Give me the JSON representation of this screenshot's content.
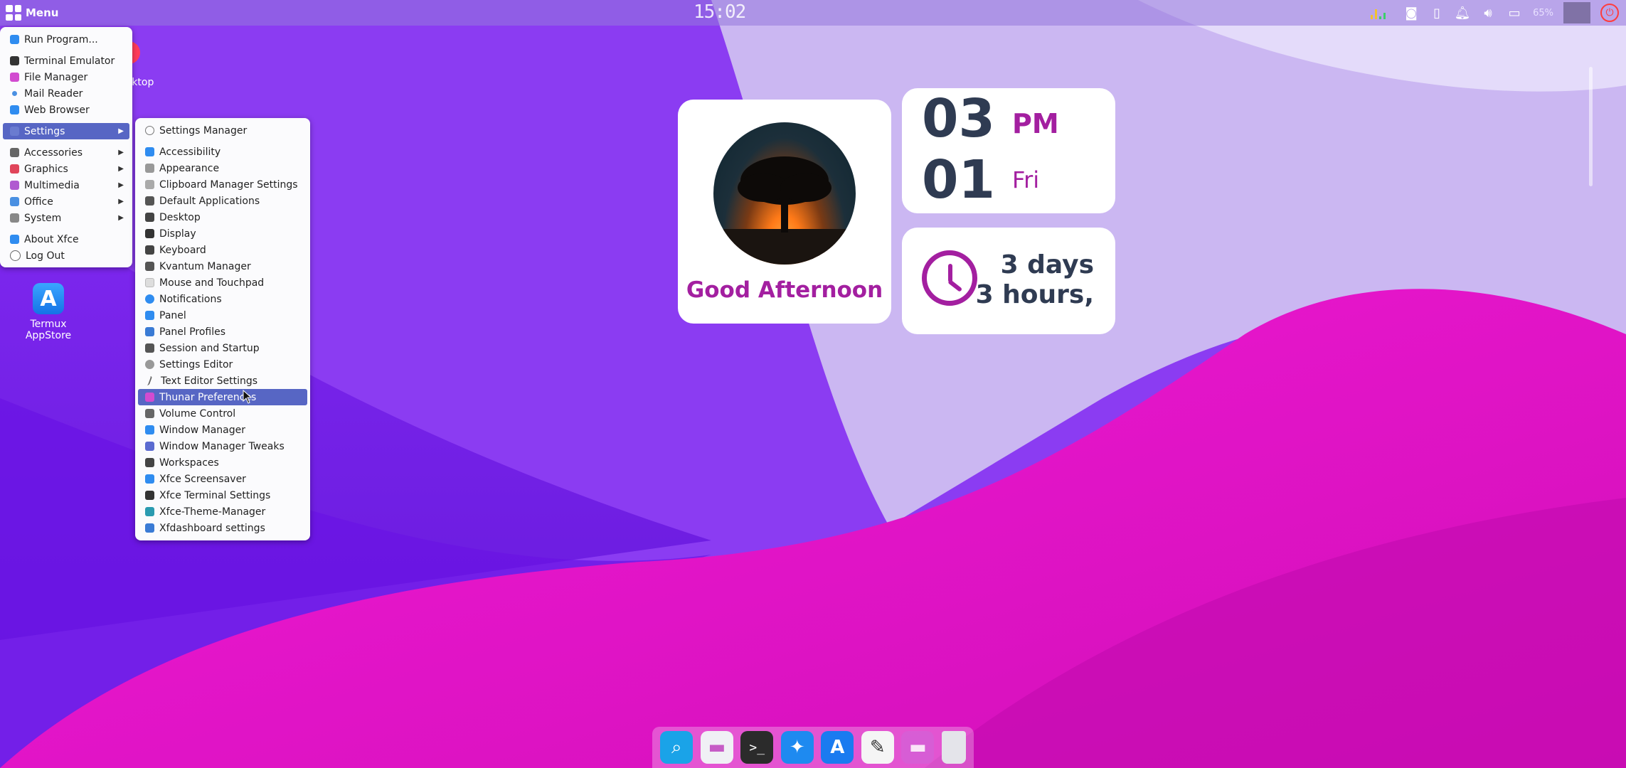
{
  "top_panel": {
    "menu_label": "Menu",
    "clock": "15:02",
    "battery_text": "65%"
  },
  "desktop": {
    "partial_label": "sktop",
    "icons": [
      {
        "label_line1": "Termux",
        "label_line2": "AppStore",
        "icon": "appstore-icon"
      }
    ]
  },
  "main_menu": {
    "items": [
      {
        "label": "Run Program...",
        "icon": "run-icon",
        "color": "#2f8cf0"
      },
      {
        "label": "Terminal Emulator",
        "icon": "terminal-icon",
        "color": "#333"
      },
      {
        "label": "File Manager",
        "icon": "folder-icon",
        "color": "#d24bd0"
      },
      {
        "label": "Mail Reader",
        "icon": "mail-icon",
        "color": "#4a90e2"
      },
      {
        "label": "Web Browser",
        "icon": "browser-icon",
        "color": "#2f8cf0"
      },
      {
        "label": "Settings",
        "icon": "settings-icon",
        "color": "#6a7bd0"
      },
      {
        "label": "Accessories",
        "icon": "accessories-icon",
        "color": "#666"
      },
      {
        "label": "Graphics",
        "icon": "graphics-icon",
        "color": "#e0455a"
      },
      {
        "label": "Multimedia",
        "icon": "multimedia-icon",
        "color": "#b05ad0"
      },
      {
        "label": "Office",
        "icon": "office-icon",
        "color": "#4a90e2"
      },
      {
        "label": "System",
        "icon": "system-icon",
        "color": "#888"
      },
      {
        "label": "About Xfce",
        "icon": "about-icon",
        "color": "#2f8cf0"
      },
      {
        "label": "Log Out",
        "icon": "logout-icon",
        "color": "#666"
      }
    ]
  },
  "settings_menu": {
    "items": [
      {
        "label": "Settings Manager",
        "color": "#777"
      },
      {
        "label": "Accessibility",
        "color": "#2f8cf0"
      },
      {
        "label": "Appearance",
        "color": "#999"
      },
      {
        "label": "Clipboard Manager Settings",
        "color": "#aaa"
      },
      {
        "label": "Default Applications",
        "color": "#555"
      },
      {
        "label": "Desktop",
        "color": "#444"
      },
      {
        "label": "Display",
        "color": "#333"
      },
      {
        "label": "Keyboard",
        "color": "#444"
      },
      {
        "label": "Kvantum Manager",
        "color": "#555"
      },
      {
        "label": "Mouse and Touchpad",
        "color": "#bbb"
      },
      {
        "label": "Notifications",
        "color": "#2f8cf0"
      },
      {
        "label": "Panel",
        "color": "#2f8cf0"
      },
      {
        "label": "Panel Profiles",
        "color": "#3a7bd5"
      },
      {
        "label": "Session and Startup",
        "color": "#555"
      },
      {
        "label": "Settings Editor",
        "color": "#999"
      },
      {
        "label": "Text Editor Settings",
        "color": "#666"
      },
      {
        "label": "Thunar Preferences",
        "color": "#d24bd0"
      },
      {
        "label": "Volume Control",
        "color": "#666"
      },
      {
        "label": "Window Manager",
        "color": "#2f8cf0"
      },
      {
        "label": "Window Manager Tweaks",
        "color": "#5a6ad0"
      },
      {
        "label": "Workspaces",
        "color": "#444"
      },
      {
        "label": "Xfce Screensaver",
        "color": "#2f8cf0"
      },
      {
        "label": "Xfce Terminal Settings",
        "color": "#333"
      },
      {
        "label": "Xfce-Theme-Manager",
        "color": "#2a9bb0"
      },
      {
        "label": "Xfdashboard settings",
        "color": "#3a7bd5"
      }
    ]
  },
  "widgets": {
    "greeting": "Good Afternoon",
    "hour": "03",
    "minute": "01",
    "ampm": "PM",
    "day": "Fri",
    "uptime_line1": "3 days",
    "uptime_line2": "3 hours,"
  },
  "dock": {
    "items": [
      {
        "icon": "search-icon",
        "color": "#1aa3e8"
      },
      {
        "icon": "folder-icon",
        "color": "#f0f0f5"
      },
      {
        "icon": "terminal-icon",
        "color": "#2b2b2b"
      },
      {
        "icon": "safari-compass-icon",
        "color": "#1e8af0"
      },
      {
        "icon": "appstore-icon",
        "color": "#1a7bf0"
      },
      {
        "icon": "text-editor-icon",
        "color": "#f5f5f5"
      },
      {
        "icon": "folder-icon",
        "color": "#d65fd6"
      },
      {
        "icon": "trash-icon",
        "color": "#e4e4ea"
      }
    ]
  }
}
